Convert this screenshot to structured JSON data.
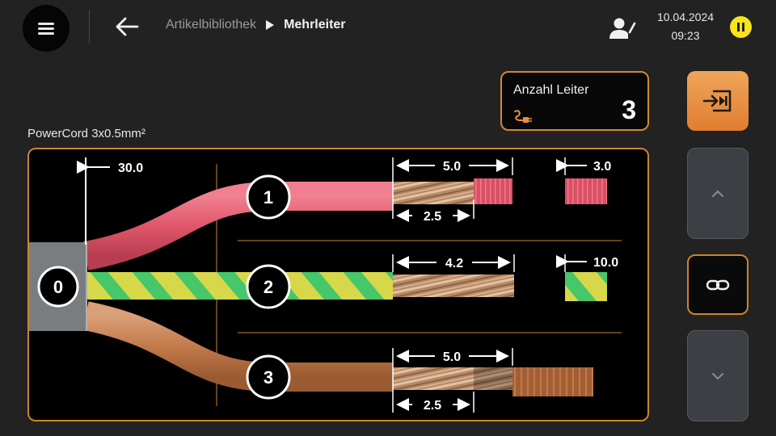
{
  "header": {
    "breadcrumb_parent": "Artikelbibliothek",
    "breadcrumb_current": "Mehrleiter",
    "date": "10.04.2024",
    "time": "09:23"
  },
  "conductor_count": {
    "label": "Anzahl Leiter",
    "value": "3"
  },
  "cable": {
    "name": "PowerCord 3x0.5mm²",
    "jacket_label": "0",
    "jacket_strip": "30.0",
    "conductors": [
      {
        "number": "1",
        "color": "red",
        "strip_total": "5.0",
        "strip_partial": "2.5",
        "end_length": "3.0"
      },
      {
        "number": "2",
        "color": "green-yellow",
        "strip_total": "4.2",
        "end_length": "10.0"
      },
      {
        "number": "3",
        "color": "brown",
        "strip_total": "5.0",
        "strip_partial": "2.5"
      }
    ]
  },
  "colors": {
    "accent": "#c9862c",
    "import_button": "#e8903f",
    "pause_indicator": "#f7e41a",
    "wire_red": "#e0566a",
    "wire_green": "#46c76a",
    "wire_yellow": "#d6d84a",
    "wire_brown": "#c27a4a",
    "copper": "#c89a70"
  },
  "icons": {
    "menu": "menu-icon",
    "back": "arrow-left-icon",
    "user": "user-edit-icon",
    "pause": "pause-icon",
    "plug": "plug-icon",
    "import": "import-icon",
    "up": "chevron-up-icon",
    "link": "link-icon",
    "down": "chevron-down-icon"
  }
}
